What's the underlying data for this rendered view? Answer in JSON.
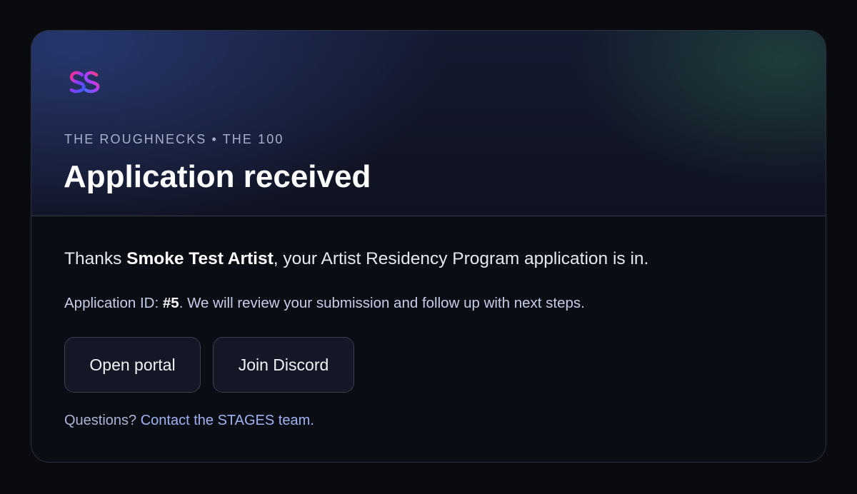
{
  "header": {
    "logo": "stages-logo",
    "eyebrow": "THE ROUGHNECKS • THE 100",
    "title": "Application received"
  },
  "message": {
    "thanks_prefix": "Thanks ",
    "artist_name": "Smoke Test Artist",
    "thanks_suffix": ", your Artist Residency Program application is in.",
    "id_prefix": "Application ID: ",
    "application_id": "#5",
    "id_suffix": ". We will review your submission and follow up with next steps."
  },
  "actions": {
    "open_portal_label": "Open portal",
    "join_discord_label": "Join Discord"
  },
  "footer": {
    "questions_prefix": "Questions? ",
    "contact_link_label": "Contact the STAGES team."
  },
  "colors": {
    "background": "#0a0b0f",
    "card": "#0c0e16",
    "accent_link": "#9fb2f2"
  }
}
